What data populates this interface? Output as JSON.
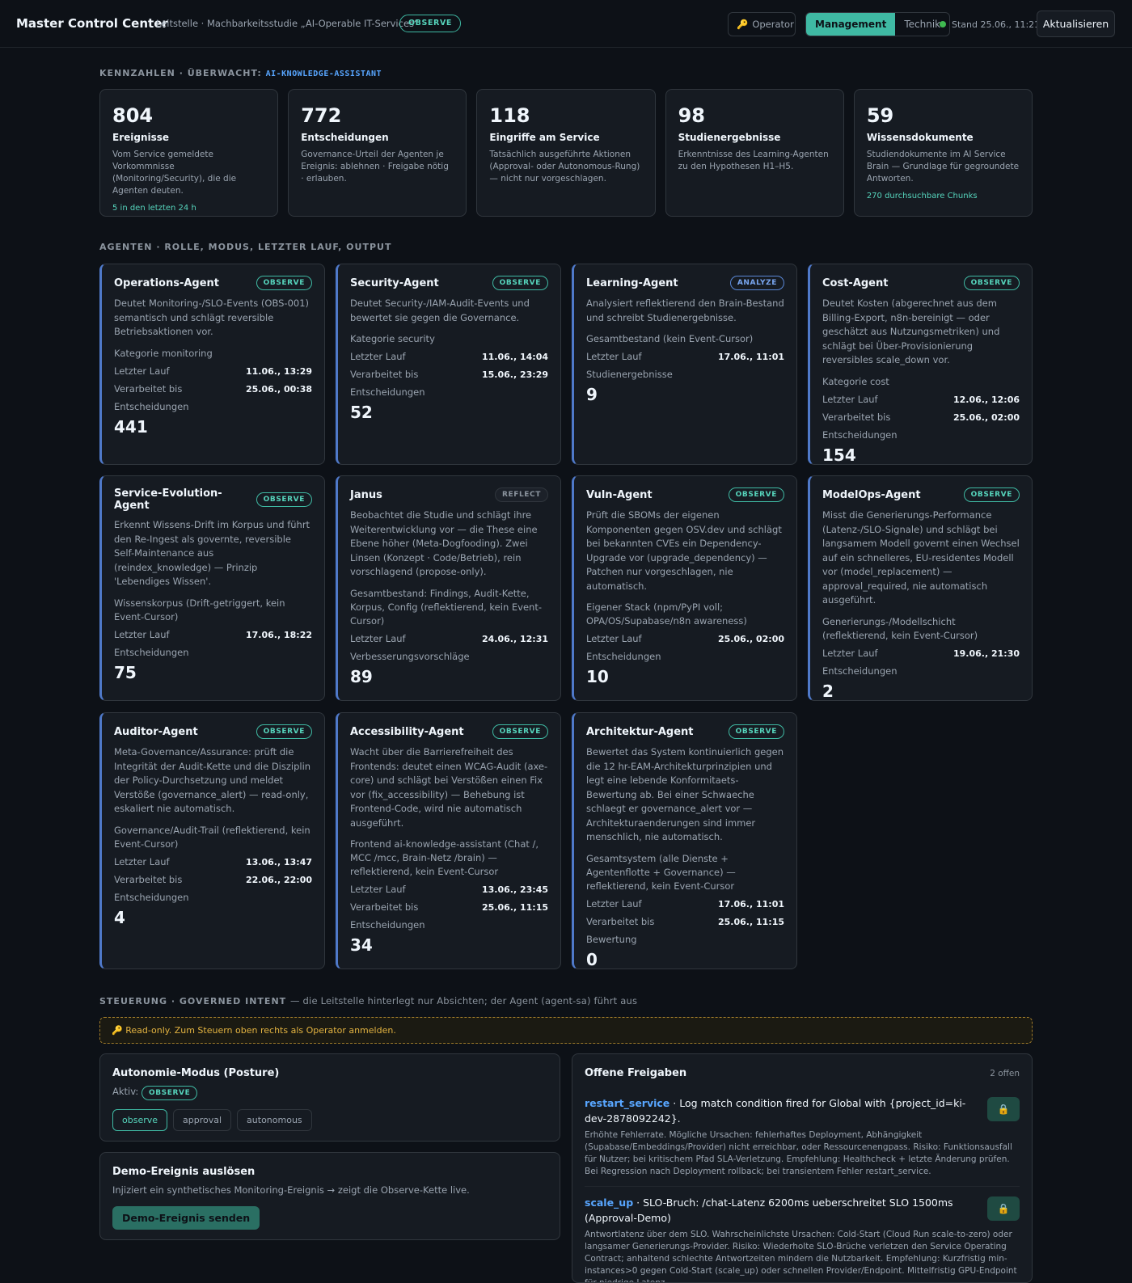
{
  "header": {
    "brand": "Master Control Center",
    "subtitle": "Leitstelle · Machbarkeitsstudie „AI-Operable IT-Services“",
    "mode_badge": "OBSERVE",
    "operator_label": "Operator",
    "view_tabs": [
      "Management",
      "Technik"
    ],
    "active_tab": "Management",
    "status_text": "Stand 25.06., 11:21",
    "refresh_label": "Aktualisieren"
  },
  "kpi_section": {
    "label": "Kennzahlen · Überwacht:",
    "service": "AI-KNOWLEDGE-ASSISTANT",
    "cards": [
      {
        "value": "804",
        "title": "Ereignisse",
        "desc": "Vom Service gemeldete Vorkommnisse (Monitoring/Security), die die Agenten deuten.",
        "foot": "5 in den letzten 24 h"
      },
      {
        "value": "772",
        "title": "Entscheidungen",
        "desc": "Governance-Urteil der Agenten je Ereignis: ablehnen · Freigabe nötig · erlauben.",
        "foot": ""
      },
      {
        "value": "118",
        "title": "Eingriffe am Service",
        "desc": "Tatsächlich ausgeführte Aktionen (Approval- oder Autonomous-Rung) — nicht nur vorgeschlagen.",
        "foot": ""
      },
      {
        "value": "98",
        "title": "Studienergebnisse",
        "desc": "Erkenntnisse des Learning-Agenten zu den Hypothesen H1–H5.",
        "foot": ""
      },
      {
        "value": "59",
        "title": "Wissensdokumente",
        "desc": "Studiendokumente im AI Service Brain — Grundlage für gegroundete Antworten.",
        "foot": "270 durchsuchbare Chunks"
      }
    ]
  },
  "agents_section": {
    "label": "Agenten · Rolle, Modus, letzter Lauf, Output",
    "agents": [
      {
        "name": "Operations-Agent",
        "mode": "OBSERVE",
        "desc": "Deutet Monitoring-/SLO-Events (OBS-001) semantisch und schlägt reversible Betriebsaktionen vor.",
        "cat": "Kategorie monitoring",
        "rows": [
          [
            "Letzter Lauf",
            "11.06., 13:29"
          ],
          [
            "Verarbeitet bis",
            "25.06., 00:38"
          ]
        ],
        "metric_label": "Entscheidungen",
        "metric": "441"
      },
      {
        "name": "Security-Agent",
        "mode": "OBSERVE",
        "desc": "Deutet Security-/IAM-Audit-Events und bewertet sie gegen die Governance.",
        "cat": "Kategorie security",
        "rows": [
          [
            "Letzter Lauf",
            "11.06., 14:04"
          ],
          [
            "Verarbeitet bis",
            "15.06., 23:29"
          ]
        ],
        "metric_label": "Entscheidungen",
        "metric": "52"
      },
      {
        "name": "Learning-Agent",
        "mode": "ANALYZE",
        "desc": "Analysiert reflektierend den Brain-Bestand und schreibt Studienergebnisse.",
        "cat": "Gesamtbestand (kein Event-Cursor)",
        "rows": [
          [
            "Letzter Lauf",
            "17.06., 11:01"
          ]
        ],
        "metric_label": "Studienergebnisse",
        "metric": "9"
      },
      {
        "name": "Cost-Agent",
        "mode": "OBSERVE",
        "desc": "Deutet Kosten (abgerechnet aus dem Billing-Export, n8n-bereinigt — oder geschätzt aus Nutzungsmetriken) und schlägt bei Über-Provisionierung reversibles scale_down vor.",
        "cat": "Kategorie cost",
        "rows": [
          [
            "Letzter Lauf",
            "12.06., 12:06"
          ],
          [
            "Verarbeitet bis",
            "25.06., 02:00"
          ]
        ],
        "metric_label": "Entscheidungen",
        "metric": "154"
      },
      {
        "name": "Service-Evolution-Agent",
        "mode": "OBSERVE",
        "desc": "Erkennt Wissens-Drift im Korpus und führt den Re-Ingest als governte, reversible Self-Maintenance aus (reindex_knowledge) — Prinzip 'Lebendiges Wissen'.",
        "cat": "Wissenskorpus (Drift-getriggert, kein Event-Cursor)",
        "rows": [
          [
            "Letzter Lauf",
            "17.06., 18:22"
          ]
        ],
        "metric_label": "Entscheidungen",
        "metric": "75"
      },
      {
        "name": "Janus",
        "mode": "REFLECT",
        "desc": "Beobachtet die Studie und schlägt ihre Weiterentwicklung vor — die These eine Ebene höher (Meta-Dogfooding). Zwei Linsen (Konzept · Code/Betrieb), rein vorschlagend (propose-only).",
        "cat": "Gesamtbestand: Findings, Audit-Kette, Korpus, Config (reflektierend, kein Event-Cursor)",
        "rows": [
          [
            "Letzter Lauf",
            "24.06., 12:31"
          ]
        ],
        "metric_label": "Verbesserungsvorschläge",
        "metric": "89"
      },
      {
        "name": "Vuln-Agent",
        "mode": "OBSERVE",
        "desc": "Prüft die SBOMs der eigenen Komponenten gegen OSV.dev und schlägt bei bekannten CVEs ein Dependency-Upgrade vor (upgrade_dependency) — Patchen nur vorgeschlagen, nie automatisch.",
        "cat": "Eigener Stack (npm/PyPI voll; OPA/OS/Supabase/n8n awareness)",
        "rows": [
          [
            "Letzter Lauf",
            "25.06., 02:00"
          ]
        ],
        "metric_label": "Entscheidungen",
        "metric": "10"
      },
      {
        "name": "ModelOps-Agent",
        "mode": "OBSERVE",
        "desc": "Misst die Generierungs-Performance (Latenz-/SLO-Signale) und schlägt bei langsamem Modell governt einen Wechsel auf ein schnelleres, EU-residentes Modell vor (model_replacement) — approval_required, nie automatisch ausgeführt.",
        "cat": "Generierungs-/Modellschicht (reflektierend, kein Event-Cursor)",
        "rows": [
          [
            "Letzter Lauf",
            "19.06., 21:30"
          ]
        ],
        "metric_label": "Entscheidungen",
        "metric": "2"
      },
      {
        "name": "Auditor-Agent",
        "mode": "OBSERVE",
        "desc": "Meta-Governance/Assurance: prüft die Integrität der Audit-Kette und die Disziplin der Policy-Durchsetzung und meldet Verstöße (governance_alert) — read-only, eskaliert nie automatisch.",
        "cat": "Governance/Audit-Trail (reflektierend, kein Event-Cursor)",
        "rows": [
          [
            "Letzter Lauf",
            "13.06., 13:47"
          ],
          [
            "Verarbeitet bis",
            "22.06., 22:00"
          ]
        ],
        "metric_label": "Entscheidungen",
        "metric": "4"
      },
      {
        "name": "Accessibility-Agent",
        "mode": "OBSERVE",
        "desc": "Wacht über die Barrierefreiheit des Frontends: deutet einen WCAG-Audit (axe-core) und schlägt bei Verstößen einen Fix vor (fix_accessibility) — Behebung ist Frontend-Code, wird nie automatisch ausgeführt.",
        "cat": "Frontend ai-knowledge-assistant (Chat /, MCC /mcc, Brain-Netz /brain) — reflektierend, kein Event-Cursor",
        "rows": [
          [
            "Letzter Lauf",
            "13.06., 23:45"
          ],
          [
            "Verarbeitet bis",
            "25.06., 11:15"
          ]
        ],
        "metric_label": "Entscheidungen",
        "metric": "34"
      },
      {
        "name": "Architektur-Agent",
        "mode": "OBSERVE",
        "desc": "Bewertet das System kontinuierlich gegen die 12 hr-EAM-Architekturprinzipien und legt eine lebende Konformitaets-Bewertung ab. Bei einer Schwaeche schlaegt er governance_alert vor — Architekturaenderungen sind immer menschlich, nie automatisch.",
        "cat": "Gesamtsystem (alle Dienste + Agentenflotte + Governance) — reflektierend, kein Event-Cursor",
        "rows": [
          [
            "Letzter Lauf",
            "17.06., 11:01"
          ],
          [
            "Verarbeitet bis",
            "25.06., 11:15"
          ]
        ],
        "metric_label": "Bewertung",
        "metric": "0"
      }
    ]
  },
  "control_section": {
    "label": "Steuerung · Governed Intent",
    "label_note": "— die Leitstelle hinterlegt nur Absichten; der Agent (agent-sa) führt aus",
    "readonly_notice": "Read-only. Zum Steuern oben rechts als Operator anmelden.",
    "posture": {
      "title": "Autonomie-Modus (Posture)",
      "active_label": "Aktiv:",
      "active_value": "OBSERVE",
      "options": [
        "observe",
        "approval",
        "autonomous"
      ]
    },
    "demo": {
      "title": "Demo-Ereignis auslösen",
      "desc": "Injiziert ein synthetisches Monitoring-Ereignis → zeigt die Observe-Kette live.",
      "button": "Demo-Ereignis senden"
    },
    "approvals": {
      "title": "Offene Freigaben",
      "count": "2 offen",
      "items": [
        {
          "action": "restart_service",
          "title": " · Log match condition fired for Global with {project_id=ki-dev-2878092242}.",
          "desc": "Erhöhte Fehlerrate. Mögliche Ursachen: fehlerhaftes Deployment, Abhängigkeit (Supabase/Embeddings/Provider) nicht erreichbar, oder Ressourcenengpass. Risiko: Funktionsausfall für Nutzer; bei kritischem Pfad SLA-Verletzung. Empfehlung: Healthcheck + letzte Änderung prüfen. Bei Regression nach Deployment rollback; bei transientem Fehler restart_service."
        },
        {
          "action": "scale_up",
          "title": " · SLO-Bruch: /chat-Latenz 6200ms ueberschreitet SLO 1500ms (Approval-Demo)",
          "desc": "Antwortlatenz über dem SLO. Wahrscheinlichste Ursachen: Cold-Start (Cloud Run scale-to-zero) oder langsamer Generierungs-Provider. Risiko: Wiederholte SLO-Brüche verletzen den Service Operating Contract; anhaltend schlechte Antwortzeiten mindern die Nutzbarkeit. Empfehlung: Kurzfristig min-instances>0 gegen Cold-Start (scale_up) oder schnellen Provider/Endpoint. Mittelfristig GPU-Endpoint für niedrige Latenz."
        }
      ]
    }
  }
}
